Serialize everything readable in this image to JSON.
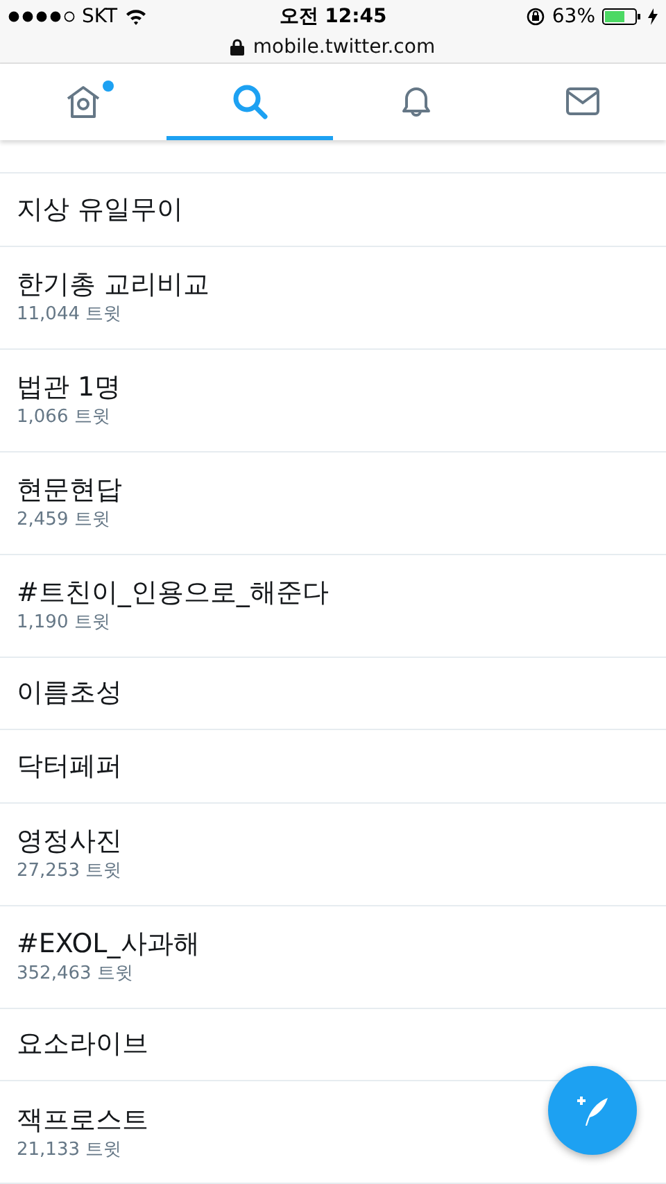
{
  "status_bar": {
    "carrier": "SKT",
    "time": "오전 12:45",
    "battery": "63%"
  },
  "address_bar": {
    "url": "mobile.twitter.com"
  },
  "tabs": [
    {
      "kind": "home",
      "selected": false,
      "dot": true
    },
    {
      "kind": "search",
      "selected": true,
      "dot": false
    },
    {
      "kind": "notifications",
      "selected": false,
      "dot": false
    },
    {
      "kind": "messages",
      "selected": false,
      "dot": false
    }
  ],
  "trends": [
    {
      "name": "지상 유일무이"
    },
    {
      "name": "한기총 교리비교",
      "count": "11,044 트윗"
    },
    {
      "name": "법관 1명",
      "count": "1,066 트윗"
    },
    {
      "name": "현문현답",
      "count": "2,459 트윗"
    },
    {
      "name": "#트친이_인용으로_해준다",
      "count": "1,190 트윗"
    },
    {
      "name": "이름초성"
    },
    {
      "name": "닥터페퍼"
    },
    {
      "name": "영정사진",
      "count": "27,253 트윗"
    },
    {
      "name": "#EXOL_사과해",
      "count": "352,463 트윗"
    },
    {
      "name": "요소라이브"
    },
    {
      "name": "잭프로스트",
      "count": "21,133 트윗"
    }
  ]
}
